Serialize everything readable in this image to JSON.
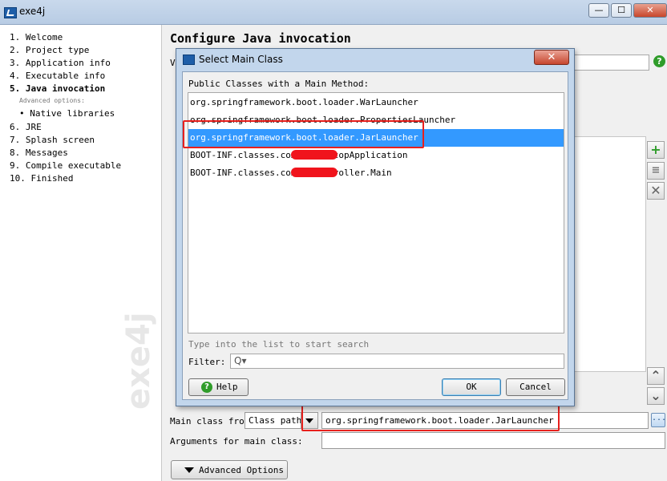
{
  "window": {
    "title": "exe4j",
    "minimize": "—",
    "maximize": "☐",
    "close": "✕"
  },
  "sidebar": {
    "steps": [
      {
        "label": "1.  Welcome"
      },
      {
        "label": "2.  Project type"
      },
      {
        "label": "3.  Application info"
      },
      {
        "label": "4.  Executable info"
      },
      {
        "label": "5.  Java invocation",
        "active": true
      },
      {
        "label": "6.  JRE"
      },
      {
        "label": "7.  Splash screen"
      },
      {
        "label": "8.  Messages"
      },
      {
        "label": "9.  Compile executable"
      },
      {
        "label": "10.  Finished"
      }
    ],
    "advanced_options_label": "Advanced options:",
    "native_libraries": "• Native libraries",
    "watermark": "exe4j"
  },
  "main": {
    "title": "Configure Java invocation",
    "partial_label": "V",
    "help_symbol": "?",
    "side_buttons": {
      "add": "+",
      "edit": "≡",
      "delete": "✕",
      "up": "⌃",
      "down": "⌄"
    },
    "main_class_label": "Main class from",
    "classpath_select": "Class path",
    "main_class_value": "org.springframework.boot.loader.JarLauncher",
    "browse_label": "...",
    "arguments_label": "Arguments for main class:",
    "advanced_options_button": "Advanced Options"
  },
  "dialog": {
    "title": "Select Main Class",
    "close": "✕",
    "caption": "Public Classes with a Main Method:",
    "classes": [
      "org.springframework.boot.loader.WarLauncher",
      "org.springframework.boot.loader.PropertiesLauncher",
      "org.springframework.boot.loader.JarLauncher",
      "BOOT-INF.classes.com.        .DesktopApplication",
      "BOOT-INF.classes.com.        .controller.Main"
    ],
    "selected_index": 2,
    "search_hint": "Type into the list to start search",
    "filter_label": "Filter:",
    "filter_icon": "Q▾",
    "help_button": "Help",
    "help_icon": "?",
    "ok_button": "OK",
    "cancel_button": "Cancel"
  },
  "colors": {
    "selection": "#3399ff",
    "highlight_box": "#e8201d",
    "redaction": "#f0141c"
  }
}
